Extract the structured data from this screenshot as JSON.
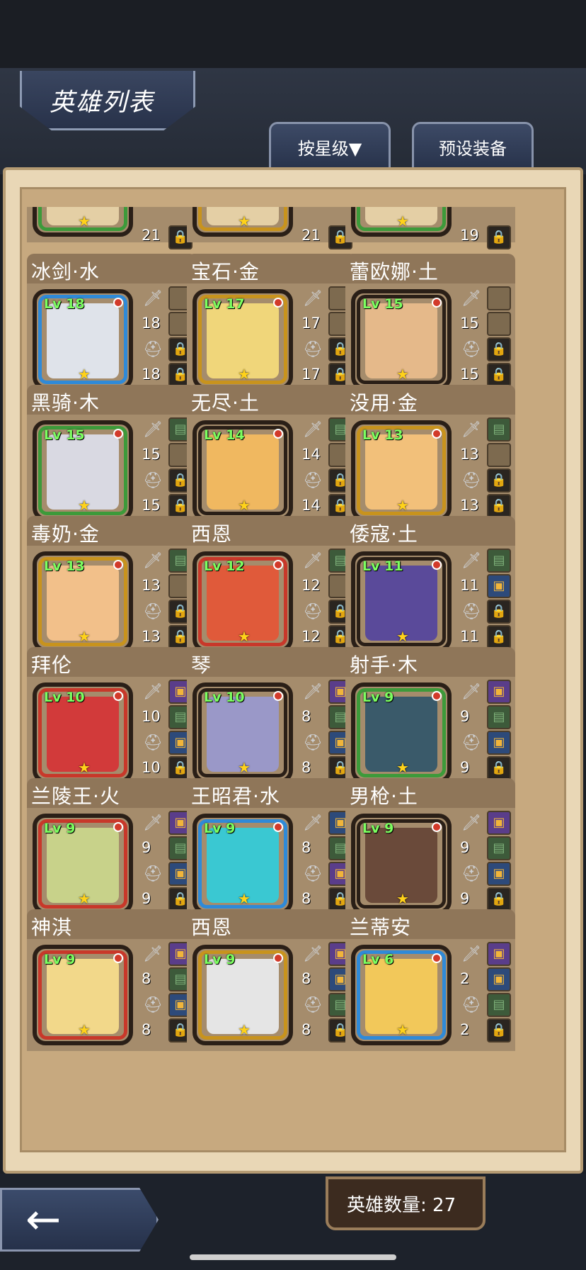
{
  "header": {
    "title": "英雄列表",
    "sort_label": "按星级▼",
    "preset_label": "预设装备"
  },
  "footer": {
    "hero_count": "英雄数量: 27",
    "back_icon": "back-arrow-icon"
  },
  "top_partial": [
    {
      "num1": "21",
      "ring": "#3d9a3a"
    },
    {
      "num1": "21",
      "ring": "#c8931d"
    },
    {
      "num1": "19",
      "ring": "#3d9a3a"
    }
  ],
  "heroes": [
    {
      "name": "冰剑·水",
      "lv": "Lv 18",
      "atk": "18",
      "def": "18",
      "ring": "#2f8ad8",
      "face": "#dfe3ea",
      "slots": [
        "",
        "",
        "lock"
      ]
    },
    {
      "name": "宝石·金",
      "lv": "Lv 17",
      "atk": "17",
      "def": "17",
      "ring": "#c8931d",
      "face": "#f0d67a",
      "slots": [
        "",
        "",
        "lock"
      ]
    },
    {
      "name": "蕾欧娜·土",
      "lv": "Lv 15",
      "atk": "15",
      "def": "15",
      "ring": "#2a1f17",
      "face": "#e5b98a",
      "slots": [
        "",
        "",
        "lock"
      ]
    },
    {
      "name": "黑骑·木",
      "lv": "Lv 15",
      "atk": "15",
      "def": "15",
      "ring": "#3d9a3a",
      "face": "#d9d9e2",
      "slots": [
        "bag",
        "",
        "lock"
      ]
    },
    {
      "name": "无尽·土",
      "lv": "Lv 14",
      "atk": "14",
      "def": "14",
      "ring": "#2a1f17",
      "face": "#f0b860",
      "slots": [
        "bag",
        "",
        "lock"
      ]
    },
    {
      "name": "没用·金",
      "lv": "Lv 13",
      "atk": "13",
      "def": "13",
      "ring": "#c8931d",
      "face": "#f2c07a",
      "slots": [
        "bag",
        "",
        "lock"
      ]
    },
    {
      "name": "毒奶·金",
      "lv": "Lv 13",
      "atk": "13",
      "def": "13",
      "ring": "#c8931d",
      "face": "#f2c08a",
      "slots": [
        "bag",
        "",
        "lock"
      ]
    },
    {
      "name": "西恩",
      "lv": "Lv 12",
      "atk": "12",
      "def": "12",
      "ring": "#c8382a",
      "face": "#e05a3a",
      "slots": [
        "bag",
        "",
        "lock"
      ]
    },
    {
      "name": "倭寇·土",
      "lv": "Lv 11",
      "atk": "11",
      "def": "11",
      "ring": "#2a1f17",
      "face": "#5a4a9a",
      "slots": [
        "bag",
        "box",
        "lock"
      ]
    },
    {
      "name": "拜伦",
      "lv": "Lv 10",
      "atk": "10",
      "def": "10",
      "ring": "#c8382a",
      "face": "#d23a3a",
      "slots": [
        "purp",
        "bag",
        "box"
      ]
    },
    {
      "name": "琴",
      "lv": "Lv 10",
      "atk": "8",
      "def": "8",
      "ring": "#2a1f17",
      "face": "#9a98c8",
      "slots": [
        "purp",
        "bag",
        "box"
      ]
    },
    {
      "name": "射手·木",
      "lv": "Lv 9",
      "atk": "9",
      "def": "9",
      "ring": "#3d9a3a",
      "face": "#3a5a6a",
      "slots": [
        "purp",
        "bag",
        "box"
      ]
    },
    {
      "name": "兰陵王·火",
      "lv": "Lv 9",
      "atk": "9",
      "def": "9",
      "ring": "#c8382a",
      "face": "#c8d28a",
      "slots": [
        "purp",
        "bag",
        "box"
      ]
    },
    {
      "name": "王昭君·水",
      "lv": "Lv 9",
      "atk": "8",
      "def": "8",
      "ring": "#2f8ad8",
      "face": "#3ac8d2",
      "slots": [
        "box",
        "bag",
        "purp"
      ]
    },
    {
      "name": "男枪·土",
      "lv": "Lv 9",
      "atk": "9",
      "def": "9",
      "ring": "#2a1f17",
      "face": "#6a4a3a",
      "slots": [
        "purp",
        "bag",
        "box"
      ]
    },
    {
      "name": "神淇",
      "lv": "Lv 9",
      "atk": "8",
      "def": "8",
      "ring": "#c8382a",
      "face": "#f2d88a",
      "slots": [
        "purp",
        "bag",
        "box"
      ]
    },
    {
      "name": "西恩",
      "lv": "Lv 9",
      "atk": "8",
      "def": "8",
      "ring": "#c8931d",
      "face": "#e5e5e5",
      "slots": [
        "purp",
        "box",
        "bag"
      ]
    },
    {
      "name": "兰蒂安",
      "lv": "Lv 6",
      "atk": "2",
      "def": "2",
      "ring": "#2f8ad8",
      "face": "#f2c85a",
      "slots": [
        "purp",
        "box",
        "bag"
      ]
    }
  ]
}
